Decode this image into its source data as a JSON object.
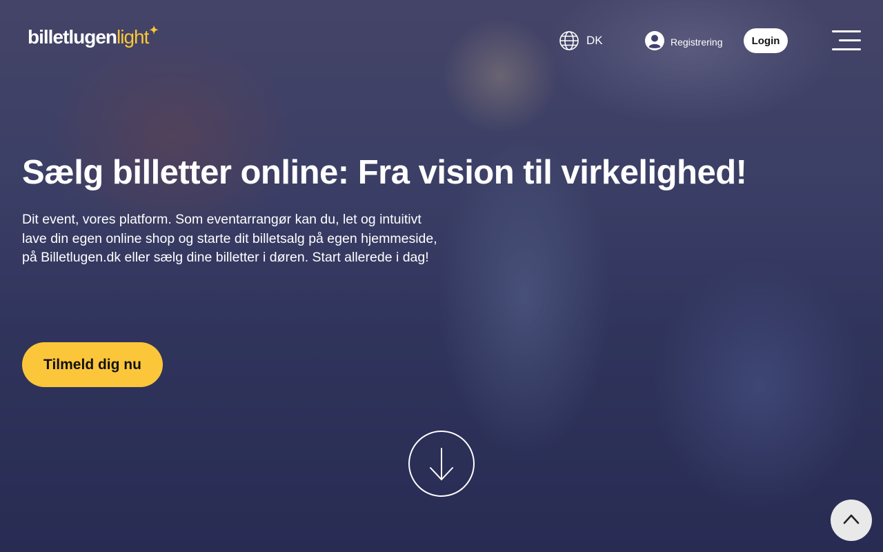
{
  "header": {
    "logo_main": "billetlugen",
    "logo_accent": "light",
    "language": "DK",
    "register_label": "Registrering",
    "login_label": "Login"
  },
  "hero": {
    "headline": "Sælg billetter online: Fra vision til virkelighed!",
    "lead": "Dit event, vores platform. Som eventarrangør kan du, let og intuitivt lave din egen online shop og starte dit billetsalg på egen hjemmeside, på Billetlugen.dk eller sælg dine billetter i døren. Start allerede i dag!",
    "cta_label": "Tilmeld dig nu"
  },
  "icons": {
    "language": "globe-icon",
    "register": "user-circle-icon",
    "menu": "hamburger-icon",
    "scroll": "arrow-down-icon",
    "back_to_top": "chevron-up-icon"
  },
  "colors": {
    "accent": "#fcc63a",
    "overlay": "#1c204a",
    "login_bg": "#ffffff",
    "back_top_bg": "#e9e9e9"
  }
}
